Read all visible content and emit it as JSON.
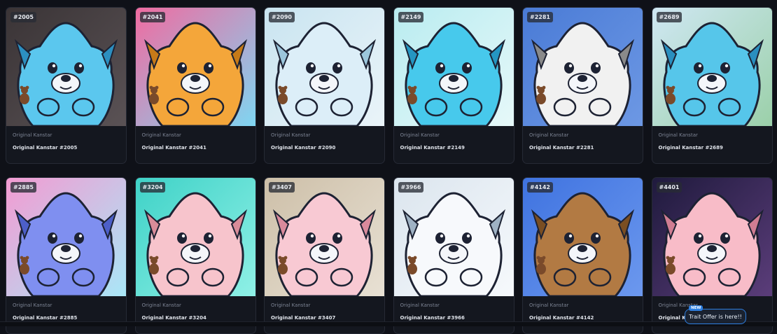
{
  "cards": [
    {
      "badge": "#2005",
      "collection": "Original Kanstar",
      "title": "Original Kanstar #2005",
      "bg": "#3a3436",
      "bg2": "#5a5255",
      "body": "#5bc7ee",
      "body_dark": "#2c8fc0"
    },
    {
      "badge": "#2041",
      "collection": "Original Kanstar",
      "title": "Original Kanstar #2041",
      "bg": "#f06ba0",
      "bg2": "#7fd6f2",
      "body": "#f4a63a",
      "body_dark": "#c67a18"
    },
    {
      "badge": "#2090",
      "collection": "Original Kanstar",
      "title": "Original Kanstar #2090",
      "bg": "#c9e4f0",
      "bg2": "#eaf4f9",
      "body": "#dceef8",
      "body_dark": "#9cc6dc"
    },
    {
      "badge": "#2149",
      "collection": "Original Kanstar",
      "title": "Original Kanstar #2149",
      "bg": "#b9ecf0",
      "bg2": "#e6f8f9",
      "body": "#47c9ec",
      "body_dark": "#2596c2"
    },
    {
      "badge": "#2281",
      "collection": "Original Kanstar",
      "title": "Original Kanstar #2281",
      "bg": "#4a7bd6",
      "bg2": "#6d98e4",
      "body": "#f1f1f1",
      "body_dark": "#8a8a8a"
    },
    {
      "badge": "#2689",
      "collection": "Original Kanstar",
      "title": "Original Kanstar #2689",
      "bg": "#cfe7f3",
      "bg2": "#9bd0a9",
      "body": "#56c6ea",
      "body_dark": "#2a8fbf"
    },
    {
      "badge": "#2885",
      "collection": "Original Kanstar",
      "title": "Original Kanstar #2885",
      "bg": "#f39bd2",
      "bg2": "#a9e7f7",
      "body": "#7f8ff0",
      "body_dark": "#4d5fc8"
    },
    {
      "badge": "#3204",
      "collection": "Original Kanstar",
      "title": "Original Kanstar #3204",
      "bg": "#3fd2c7",
      "bg2": "#8ff0e6",
      "body": "#f7c4cc",
      "body_dark": "#d88c99"
    },
    {
      "badge": "#3407",
      "collection": "Original Kanstar",
      "title": "Original Kanstar #3407",
      "bg": "#cdbfa8",
      "bg2": "#e8e1d4",
      "body": "#f8c9d3",
      "body_dark": "#d98a9c"
    },
    {
      "badge": "#3966",
      "collection": "Original Kanstar",
      "title": "Original Kanstar #3966",
      "bg": "#dbe5ee",
      "bg2": "#f6f9fc",
      "body": "#f7f9fc",
      "body_dark": "#9fb2c4"
    },
    {
      "badge": "#4142",
      "collection": "Original Kanstar",
      "title": "Original Kanstar #4142",
      "bg": "#3f73e0",
      "bg2": "#6c98ee",
      "body": "#b27a43",
      "body_dark": "#7a4e22"
    },
    {
      "badge": "#4401",
      "collection": "Original Kanstar",
      "title": "Original Kanstar #4401",
      "bg": "#1f1a3d",
      "bg2": "#5b3d7a",
      "body": "#f8bcc8",
      "body_dark": "#d07d92"
    }
  ],
  "toast": {
    "new_label": "NEW",
    "text": "Trait Offer is here!!"
  }
}
